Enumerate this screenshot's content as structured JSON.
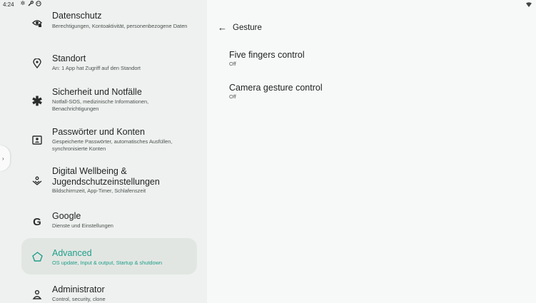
{
  "status_bar": {
    "time": "4:24"
  },
  "detail": {
    "title": "Gesture",
    "items": [
      {
        "title": "Five fingers control",
        "summary": "Off"
      },
      {
        "title": "Camera gesture control",
        "summary": "Off"
      }
    ]
  },
  "settings_list": [
    {
      "icon": "privacy-icon",
      "title": "Datenschutz",
      "summary": "Berechtigungen, Kontoaktivität, personenbezogene Daten"
    },
    {
      "icon": "location-icon",
      "title": "Standort",
      "summary": "An: 1 App hat Zugriff auf den Standort"
    },
    {
      "icon": "emergency-icon",
      "title": "Sicherheit und Notfälle",
      "summary": "Notfall-SOS, medizinische Informationen, Benachrichtigungen"
    },
    {
      "icon": "accounts-icon",
      "title": "Passwörter und Konten",
      "summary": "Gespeicherte Passwörter, automatisches Ausfüllen, synchronisierte Konten"
    },
    {
      "icon": "wellbeing-icon",
      "title": "Digital Wellbeing & Jugendschutzeinstellungen",
      "summary": "Bildschirmzeit, App-Timer, Schlafenszeit"
    },
    {
      "icon": "google-icon",
      "title": "Google",
      "summary": "Dienste und Einstellungen"
    },
    {
      "icon": "advanced-icon",
      "title": "Advanced",
      "summary": "OS update, Input & output, Startup & shutdown"
    },
    {
      "icon": "administrator-icon",
      "title": "Administrator",
      "summary": "Control, security, clone"
    }
  ],
  "colors": {
    "accent": "#1f9e8b",
    "left_pane_bg": "#eef1ef",
    "right_pane_bg": "#f7f9f8",
    "active_item_bg": "#e2e6e2"
  }
}
